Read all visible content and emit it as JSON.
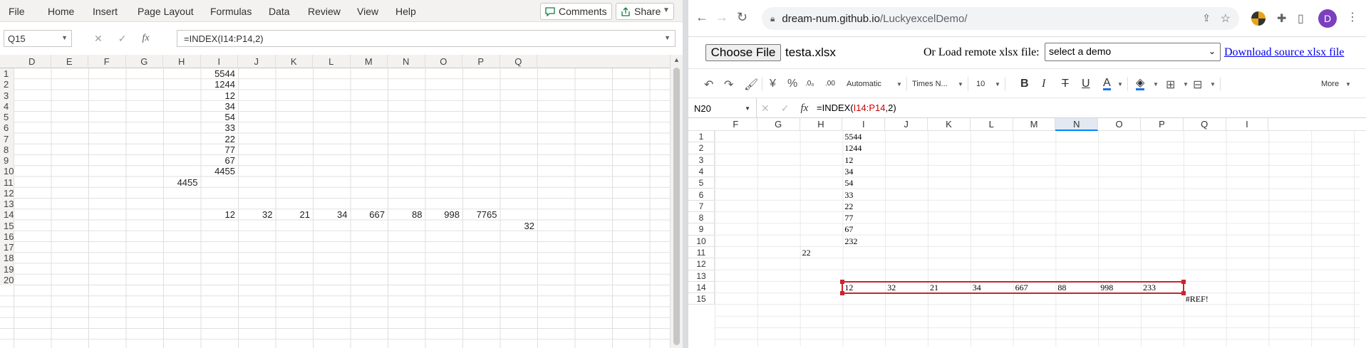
{
  "excel": {
    "menu": [
      "File",
      "Home",
      "Insert",
      "Page Layout",
      "Formulas",
      "Data",
      "Review",
      "View",
      "Help"
    ],
    "comments_label": "Comments",
    "share_label": "Share",
    "namebox": "Q15",
    "formula": "=INDEX(I14:P14,2)",
    "columns": [
      "D",
      "E",
      "F",
      "G",
      "H",
      "I",
      "J",
      "K",
      "L",
      "M",
      "N",
      "O",
      "P",
      "Q"
    ],
    "rows": [
      "1",
      "2",
      "3",
      "4",
      "5",
      "6",
      "7",
      "8",
      "9",
      "10",
      "11",
      "12",
      "13",
      "14",
      "15",
      "16",
      "17",
      "18",
      "19",
      "20"
    ],
    "cells": {
      "I1": "5544",
      "I2": "1244",
      "I3": "12",
      "I4": "34",
      "I5": "54",
      "I6": "33",
      "I7": "22",
      "I8": "77",
      "I9": "67",
      "I10": "4455",
      "H11": "4455",
      "I14": "12",
      "J14": "32",
      "K14": "21",
      "L14": "34",
      "M14": "667",
      "N14": "88",
      "O14": "998",
      "P14": "7765",
      "Q15": "32"
    }
  },
  "browser": {
    "url_host": "dream-num.github.io",
    "url_path": "/LuckyexcelDemo/",
    "profile_initial": "D"
  },
  "demo": {
    "choose_file_label": "Choose File",
    "chosen_file": "testa.xlsx",
    "remote_label": "Or Load remote xlsx file:",
    "select_value": "select a demo",
    "download_link": "Download source xlsx file"
  },
  "lucky": {
    "toolbar": {
      "currency": "¥",
      "percent": "%",
      "dec_inc": ".0₀",
      "dec_dec": ".00",
      "format": "Automatic",
      "font": "Times N...",
      "size": "10",
      "bold": "B",
      "italic": "I",
      "strike": "T",
      "underline": "U",
      "textcolor": "A",
      "more": "More"
    },
    "namebox": "N20",
    "formula_prefix": "=INDEX(",
    "formula_ref": "I14:P14",
    "formula_suffix": ",2)",
    "columns": [
      "F",
      "G",
      "H",
      "I",
      "J",
      "K",
      "L",
      "M",
      "N",
      "O",
      "P",
      "Q",
      "I"
    ],
    "rows": [
      "1",
      "2",
      "3",
      "4",
      "5",
      "6",
      "7",
      "8",
      "9",
      "10",
      "11",
      "12",
      "13",
      "14",
      "15"
    ],
    "cells": {
      "I1": "5544",
      "I2": "1244",
      "I3": "12",
      "I4": "34",
      "I5": "54",
      "I6": "33",
      "I7": "22",
      "I8": "77",
      "I9": "67",
      "I10": "232",
      "H11": "22",
      "I14": "12",
      "J14": "32",
      "K14": "21",
      "L14": "34",
      "M14": "667",
      "N14": "88",
      "O14": "998",
      "P14": "233",
      "Q15": "#REF!"
    }
  }
}
